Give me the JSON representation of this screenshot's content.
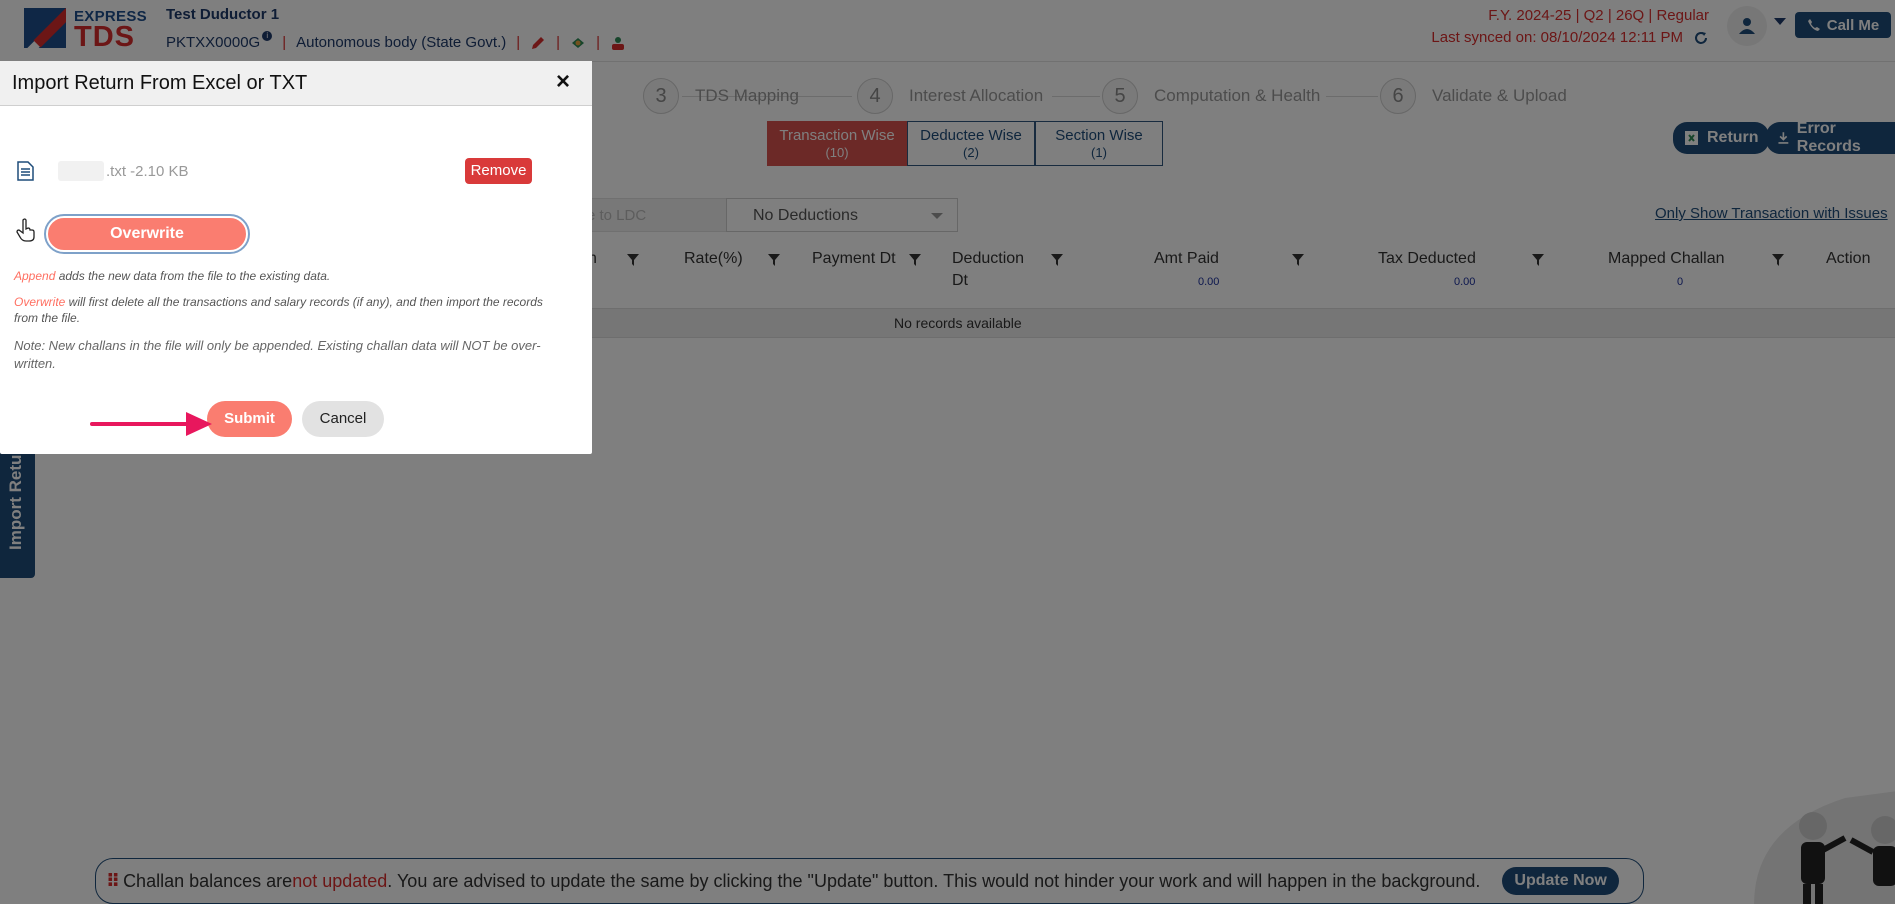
{
  "header": {
    "logo_express": "EXPRESS",
    "logo_tds": "TDS",
    "deductor_name": "Test Duductor 1",
    "tan": "PKTXX0000G",
    "deductor_type": "Autonomous body (State Govt.)",
    "fy_line": "F.Y. 2024-25  | Q2  | 26Q | Regular",
    "last_synced": "Last synced on: 08/10/2024 12:11 PM",
    "call_me": "Call Me"
  },
  "steps": [
    {
      "num": "3",
      "label": "TDS Mapping"
    },
    {
      "num": "4",
      "label": "Interest Allocation"
    },
    {
      "num": "5",
      "label": "Computation & Health"
    },
    {
      "num": "6",
      "label": "Validate & Upload"
    }
  ],
  "view_toggle": {
    "transaction": {
      "label": "Transaction Wise",
      "count": "(10)"
    },
    "deductee": {
      "label": "Deductee Wise",
      "count": "(2)"
    },
    "section": {
      "label": "Section Wise",
      "count": "(1)"
    }
  },
  "actions": {
    "return": "Return",
    "error_records": "Error Records"
  },
  "filters": {
    "ldc_placeholder": "e to LDC",
    "deduction_select": "No Deductions",
    "issues_link": "Only Show Transaction with Issues"
  },
  "table": {
    "columns": {
      "partial": "n",
      "rate": "Rate(%)",
      "payment_dt": "Payment Dt",
      "deduction_dt": "Deduction Dt",
      "amt_paid": "Amt Paid",
      "tax_deducted": "Tax Deducted",
      "mapped_challan": "Mapped Challan",
      "action": "Action"
    },
    "totals": {
      "amt_paid": "0.00",
      "tax_deducted": "0.00",
      "mapped_challan": "0"
    },
    "empty_message": "No records available"
  },
  "side_tab": "Import Retu",
  "banner": {
    "text_before": "Challan balances are ",
    "highlight": "not updated",
    "text_after": ". You are advised to update the same by clicking the \"Update\" button. This would not hinder your work and will happen in the background.",
    "button": "Update Now"
  },
  "modal": {
    "title": "Import Return From Excel or TXT",
    "close": "×",
    "file_name": ".txt -2.10 KB",
    "remove": "Remove",
    "overwrite": "Overwrite",
    "append_kw": "Append",
    "append_text": " adds the new data from the file to the existing data.",
    "overwrite_kw": "Overwrite",
    "overwrite_text": " will first delete all the transactions and salary records (if any), and then import the records from the file.",
    "note": "Note: New challans in the file will only be appended. Existing challan data will NOT be over-written.",
    "submit": "Submit",
    "cancel": "Cancel"
  },
  "colors": {
    "primary": "#1f4d7a",
    "accent_red": "#d92c2c",
    "button_salmon": "#fa7d70",
    "arrow": "#e8175d"
  }
}
